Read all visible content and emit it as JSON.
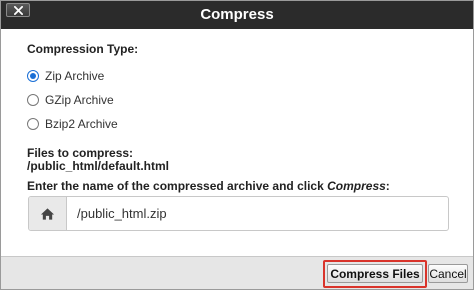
{
  "dialog": {
    "title": "Compress",
    "close_icon": "close-x-icon"
  },
  "compression": {
    "label": "Compression Type:",
    "options": [
      {
        "label": "Zip Archive",
        "checked": true
      },
      {
        "label": "GZip Archive",
        "checked": false
      },
      {
        "label": "Bzip2 Archive",
        "checked": false
      }
    ]
  },
  "files": {
    "label": "Files to compress:",
    "path": "/public_html/default.html"
  },
  "archive": {
    "prompt_prefix": "Enter the name of the compressed archive and click ",
    "prompt_emphasis": "Compress",
    "prompt_suffix": ":",
    "value": "/public_html.zip",
    "icon": "home-icon"
  },
  "footer": {
    "compress_label": "Compress Files",
    "cancel_label": "Cancel",
    "highlight_color": "#d9342b"
  }
}
